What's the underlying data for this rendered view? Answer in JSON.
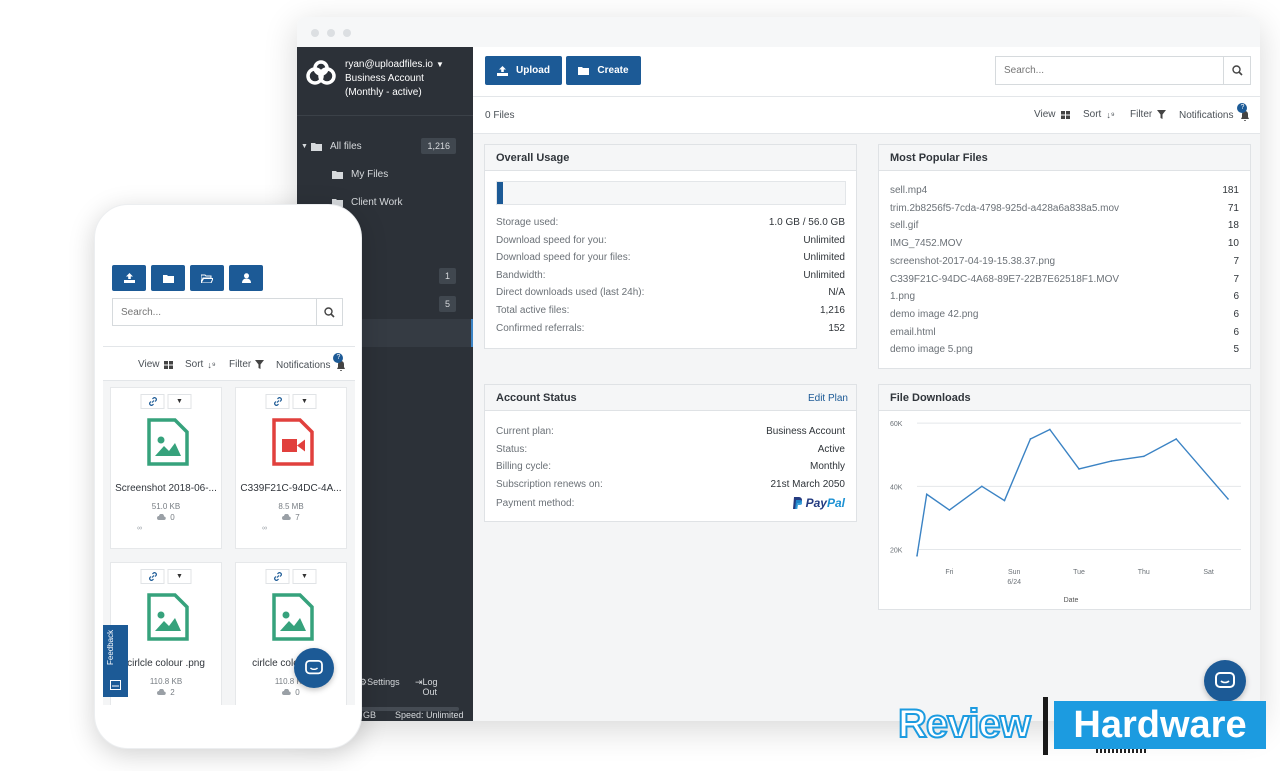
{
  "colors": {
    "primary": "#1c5a96",
    "sidebar_bg": "#2c3138",
    "accent_line": "#3b83c4",
    "image_icon": "#36a27c",
    "video_icon": "#e1403d",
    "watermark": "#1c9be0"
  },
  "sidebar": {
    "account_email": "ryan@uploadfiles.io",
    "account_type": "Business Account",
    "account_status": "(Monthly - active)",
    "items": [
      {
        "label": "All files",
        "badge": "1,216",
        "icon": "folder-icon"
      },
      {
        "label": "My Files",
        "icon": "folder-icon"
      },
      {
        "label": "Client Work",
        "icon": "folder-icon"
      }
    ],
    "extra_badges": [
      "1",
      "5"
    ],
    "settings_label": "Settings",
    "logout_label": "Log Out",
    "storage_suffix": "GB",
    "speed_label": "Speed: Unlimited"
  },
  "toolbar": {
    "upload_label": "Upload",
    "create_label": "Create",
    "search_placeholder": "Search..."
  },
  "subbar": {
    "files_count": "0 Files",
    "view_label": "View",
    "sort_label": "Sort",
    "filter_label": "Filter",
    "notifications_label": "Notifications",
    "notifications_badge": "?"
  },
  "overall_usage": {
    "title": "Overall Usage",
    "storage_fraction": 0.018,
    "rows": [
      {
        "label": "Storage used:",
        "value": "1.0 GB / 56.0 GB"
      },
      {
        "label": "Download speed for you:",
        "value": "Unlimited"
      },
      {
        "label": "Download speed for your files:",
        "value": "Unlimited"
      },
      {
        "label": "Bandwidth:",
        "value": "Unlimited"
      },
      {
        "label": "Direct downloads used (last 24h):",
        "value": "N/A"
      },
      {
        "label": "Total active files:",
        "value": "1,216"
      },
      {
        "label": "Confirmed referrals:",
        "value": "152"
      }
    ]
  },
  "popular_files": {
    "title": "Most Popular Files",
    "rows": [
      {
        "name": "sell.mp4",
        "count": "181"
      },
      {
        "name": "trim.2b8256f5-7cda-4798-925d-a428a6a838a5.mov",
        "count": "71"
      },
      {
        "name": "sell.gif",
        "count": "18"
      },
      {
        "name": "IMG_7452.MOV",
        "count": "10"
      },
      {
        "name": "screenshot-2017-04-19-15.38.37.png",
        "count": "7"
      },
      {
        "name": "C339F21C-94DC-4A68-89E7-22B7E62518F1.MOV",
        "count": "7"
      },
      {
        "name": "1.png",
        "count": "6"
      },
      {
        "name": "demo image 42.png",
        "count": "6"
      },
      {
        "name": "email.html",
        "count": "6"
      },
      {
        "name": "demo image 5.png",
        "count": "5"
      }
    ]
  },
  "account_status": {
    "title": "Account Status",
    "edit_label": "Edit Plan",
    "rows": [
      {
        "label": "Current plan:",
        "value": "Business Account"
      },
      {
        "label": "Status:",
        "value": "Active"
      },
      {
        "label": "Billing cycle:",
        "value": "Monthly"
      },
      {
        "label": "Subscription renews on:",
        "value": "21st March 2050"
      }
    ],
    "payment_label": "Payment method:",
    "payment_brand_a": "Pay",
    "payment_brand_b": "Pal"
  },
  "chart_data": {
    "type": "line",
    "title": "File Downloads",
    "xlabel": "Date",
    "ylabel": "",
    "x_tick_labels": [
      "Fri",
      "Sun",
      "Tue",
      "Thu",
      "Sat"
    ],
    "x_tick_sub": [
      "",
      "6/24",
      "",
      "",
      ""
    ],
    "x_tick_index": [
      1,
      3,
      5,
      7,
      9
    ],
    "y_tick_labels": [
      "60K",
      "40K",
      "20K"
    ],
    "y_ticks": [
      60000,
      40000,
      20000
    ],
    "ylim": [
      17000,
      61000
    ],
    "grid": true,
    "series": [
      {
        "x": [
          0,
          0.3,
          1,
          2,
          2.7,
          3.5,
          4.1,
          5,
          6,
          7,
          8,
          9.6
        ],
        "values": [
          18000,
          37500,
          32500,
          40000,
          35500,
          55000,
          58000,
          45500,
          48000,
          49500,
          55000,
          36000
        ],
        "color": "#3b83c4"
      }
    ]
  },
  "phone": {
    "search_placeholder": "Search...",
    "view_label": "View",
    "sort_label": "Sort",
    "filter_label": "Filter",
    "notifications_label": "Notifications",
    "feedback_label": "Feedback",
    "cards": [
      {
        "name": "Screenshot 2018-06-...",
        "size": "51.0 KB",
        "downloads": "0",
        "info": "∞",
        "type": "image"
      },
      {
        "name": "C339F21C-94DC-4A...",
        "size": "8.5 MB",
        "downloads": "7",
        "info": "∞",
        "type": "video"
      },
      {
        "name": "cirlcle colour .png",
        "size": "110.8 KB",
        "downloads": "2",
        "info": "",
        "type": "image"
      },
      {
        "name": "cirlcle colour .png",
        "size": "110.8 KB",
        "downloads": "0",
        "info": "",
        "type": "image"
      }
    ]
  },
  "watermark": {
    "part1": "Review",
    "part2": "Hardware"
  }
}
